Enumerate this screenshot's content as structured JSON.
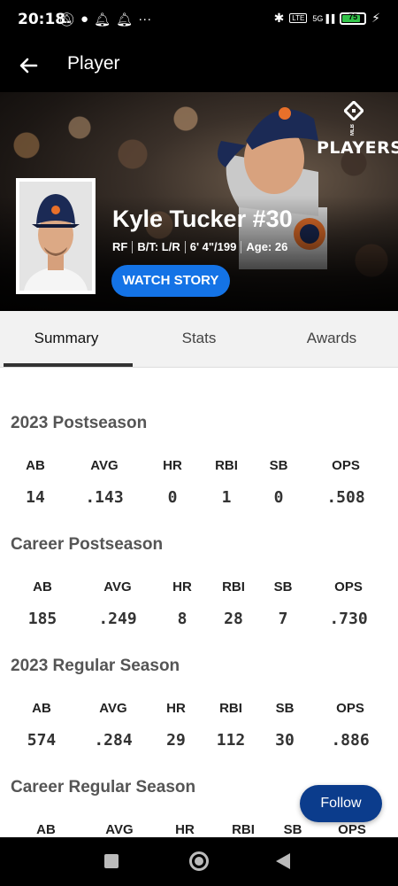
{
  "status_bar": {
    "time": "20:18",
    "icons_left": [
      "muted-alarm-icon",
      "messenger-icon",
      "notification-icon",
      "notification-icon",
      "more-icon"
    ],
    "icons_right": [
      "bluetooth-icon",
      "volte-icon",
      "5g-signal-icon",
      "battery-icon",
      "charging-icon"
    ],
    "network": "5G",
    "battery_percent": "75"
  },
  "header": {
    "title": "Player",
    "back_icon": "arrow-left-icon"
  },
  "hero": {
    "logo_text": "PLAYERS",
    "logo_prefix": "MLB",
    "player_name": "Kyle Tucker #30",
    "position": "RF",
    "bats_throws": "B/T: L/R",
    "height_weight": "6' 4\"/199",
    "age": "Age: 26",
    "watch_button": "WATCH STORY"
  },
  "tabs": [
    {
      "label": "Summary",
      "active": true
    },
    {
      "label": "Stats",
      "active": false
    },
    {
      "label": "Awards",
      "active": false
    }
  ],
  "sections": [
    {
      "title": "2023 Postseason",
      "headers": [
        "AB",
        "AVG",
        "HR",
        "RBI",
        "SB",
        "OPS"
      ],
      "values": [
        "14",
        ".143",
        "0",
        "1",
        "0",
        ".508"
      ]
    },
    {
      "title": "Career Postseason",
      "headers": [
        "AB",
        "AVG",
        "HR",
        "RBI",
        "SB",
        "OPS"
      ],
      "values": [
        "185",
        ".249",
        "8",
        "28",
        "7",
        ".730"
      ]
    },
    {
      "title": "2023 Regular Season",
      "headers": [
        "AB",
        "AVG",
        "HR",
        "RBI",
        "SB",
        "OPS"
      ],
      "values": [
        "574",
        ".284",
        "29",
        "112",
        "30",
        ".886"
      ]
    },
    {
      "title": "Career Regular Season",
      "headers": [
        "AB",
        "AVG",
        "HR",
        "RBI",
        "SB",
        "OPS"
      ],
      "values": []
    }
  ],
  "follow_button": "Follow",
  "colors": {
    "accent_blue": "#1473e6",
    "follow_blue": "#0b3c8c",
    "battery_green": "#33c34a"
  }
}
